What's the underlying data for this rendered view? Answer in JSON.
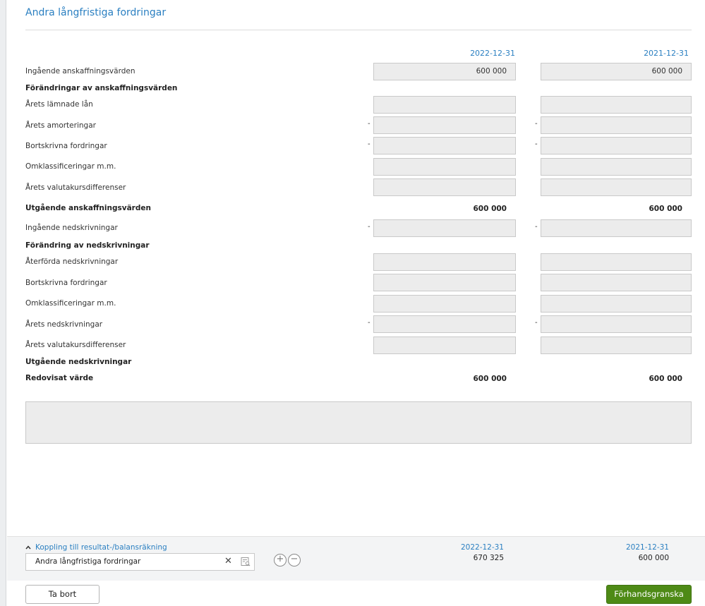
{
  "form": {
    "title": "Andra långfristiga fordringar",
    "col1_date": "2022-12-31",
    "col2_date": "2021-12-31"
  },
  "rows": {
    "ingaende_anskaffning": {
      "label": "Ingående anskaffningsvärden",
      "col1": "600 000",
      "col2": "600 000"
    },
    "forandringar_anskaffning": {
      "label": "Förändringar av anskaffningsvärden"
    },
    "arets_lamnade_lan": {
      "label": "Årets lämnade lån",
      "col1": "",
      "col2": ""
    },
    "arets_amorteringar": {
      "label": "Årets amorteringar",
      "col1": "",
      "col2": "",
      "sign": "-"
    },
    "bortskrivna_fordringar_1": {
      "label": "Bortskrivna fordringar",
      "col1": "",
      "col2": "",
      "sign": "-"
    },
    "omklassificeringar_1": {
      "label": "Omklassificeringar m.m.",
      "col1": "",
      "col2": ""
    },
    "arets_valutakurs_1": {
      "label": "Årets valutakursdifferenser",
      "col1": "",
      "col2": ""
    },
    "utgaende_anskaffning": {
      "label": "Utgående anskaffningsvärden",
      "col1": "600 000",
      "col2": "600 000"
    },
    "ingaende_nedskrivningar": {
      "label": "Ingående nedskrivningar",
      "col1": "",
      "col2": "",
      "sign": "-"
    },
    "forandring_nedskrivningar": {
      "label": "Förändring av nedskrivningar"
    },
    "aterforda_nedskrivningar": {
      "label": "Återförda nedskrivningar",
      "col1": "",
      "col2": ""
    },
    "bortskrivna_fordringar_2": {
      "label": "Bortskrivna fordringar",
      "col1": "",
      "col2": ""
    },
    "omklassificeringar_2": {
      "label": "Omklassificeringar m.m.",
      "col1": "",
      "col2": ""
    },
    "arets_nedskrivningar": {
      "label": "Årets nedskrivningar",
      "col1": "",
      "col2": "",
      "sign": "-"
    },
    "arets_valutakurs_2": {
      "label": "Årets valutakursdifferenser",
      "col1": "",
      "col2": ""
    },
    "utgaende_nedskrivningar": {
      "label": "Utgående nedskrivningar"
    },
    "redovisat_varde": {
      "label": "Redovisat värde",
      "col1": "600 000",
      "col2": "600 000"
    }
  },
  "comment": {
    "value": ""
  },
  "footer": {
    "link_label": "Koppling till resultat-/balansräkning",
    "account_value": "Andra långfristiga fordringar",
    "add_icon": "plus-circle-icon",
    "remove_icon": "minus-circle-icon",
    "col1_date": "2022-12-31",
    "col1_value": "670 325",
    "col2_date": "2021-12-31",
    "col2_value": "600 000"
  },
  "actions": {
    "remove_label": "Ta bort",
    "preview_label": "Förhandsgranska"
  },
  "colors": {
    "accent": "#2a7fc1",
    "primary_button": "#4e8a16",
    "field_bg": "#ececec"
  }
}
